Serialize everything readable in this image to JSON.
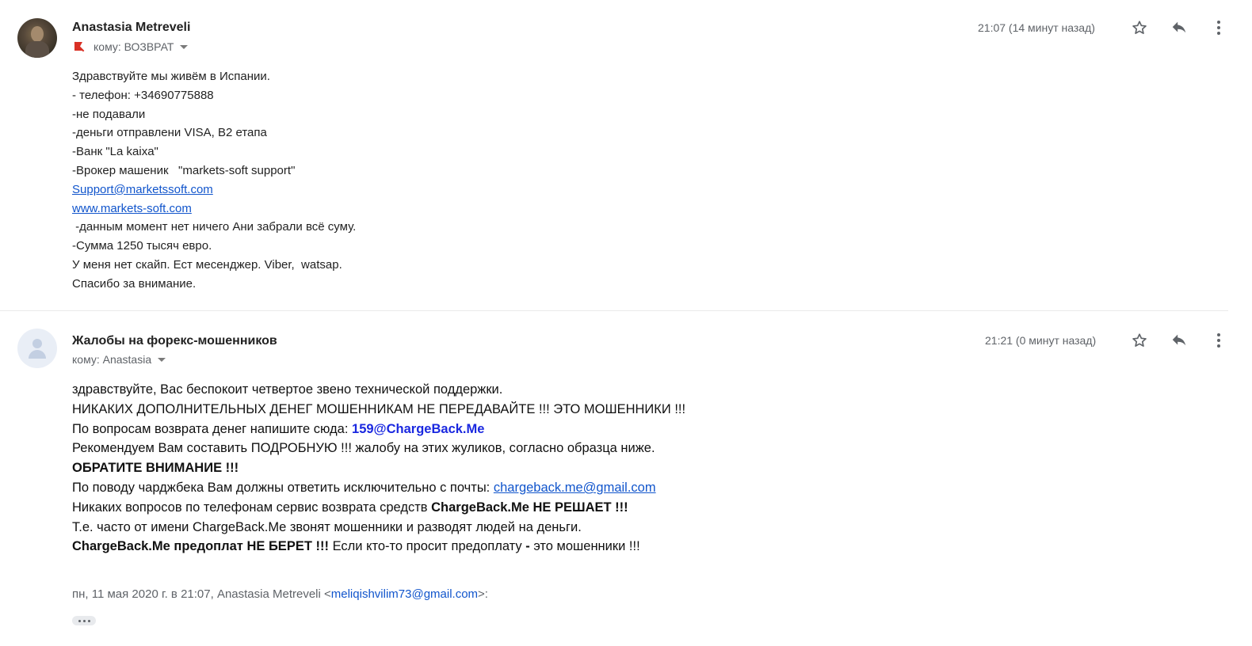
{
  "message1": {
    "sender": "Anastasia Metreveli",
    "to_label": "кому: ВОЗВРАТ",
    "time": "21:07 (14 минут назад)",
    "body": {
      "l1": "Здравствуйте мы живём в Испании.",
      "l2": "- телефон: +34690775888",
      "l3": "-не подавали",
      "l4": "-деньги отправлени VISA, B2 етапа",
      "l5": "-Ванк \"La kaixa\"",
      "l6": "-Врокер машеник   \"markets-soft support\"",
      "link1": "Support@marketssoft.com",
      "link2": "www.markets-soft.com",
      "l9": " -данным момент нет ничего Ани забрали всё суму.",
      "l10": "-Сумма 1250 тысяч евро.",
      "l11": "У меня нет скайп. Ест месенджер. Viber,  watsap.",
      "l12": "Спасибо за внимание."
    }
  },
  "message2": {
    "sender": "Жалобы на форекс-мошенников",
    "to_label": "кому: Anastasia",
    "time": "21:21 (0 минут назад)",
    "body": {
      "l1": "здравствуйте, Вас беспокоит четвертое звено технической поддержки.",
      "l2": "НИКАКИХ ДОПОЛНИТЕЛЬНЫХ ДЕНЕГ МОШЕННИКАМ НЕ ПЕРЕДАВАЙТЕ !!! ЭТО МОШЕННИКИ !!!",
      "l3a": "По вопросам возврата денег напишите сюда: ",
      "l3b": "159@ChargeBack.Me",
      "l4": "Рекомендуем Вам составить ПОДРОБНУЮ !!! жалобу на этих жуликов, согласно образца ниже.",
      "l5": "ОБРАТИТЕ ВНИМАНИЕ !!!",
      "l6a": "По поводу чарджбека Вам должны ответить исключительно с почты: ",
      "l6b": "chargeback.me@gmail.com",
      "l7a": "Никаких вопросов по телефонам сервис возврата средств ",
      "l7b": "ChargeBack.Me НЕ РЕШАЕТ !!!",
      "l8": "Т.е. часто от имени ChargeBack.Me звонят мошенники и разводят людей на деньги.",
      "l9a": "ChargeBack.Me предоплат НЕ БЕРЕТ !!!",
      "l9b": " Если кто-то просит предоплату ",
      "l9c": "-",
      "l9d": " это мошенники !!!"
    },
    "quote": {
      "prefix": "пн, 11 мая 2020 г. в 21:07, Anastasia Metreveli <",
      "email": "meliqishvilim73@gmail.com",
      "suffix": ">:"
    }
  },
  "icons": {
    "star": "star-outline-icon",
    "reply": "reply-arrow-icon",
    "more": "more-vert-icon",
    "important": "not-important-flag-icon"
  },
  "colors": {
    "link": "#1155cc",
    "chargeback_email": "#1a28e0",
    "secondary_text": "#5f6368",
    "important_flag": "#d93025"
  }
}
